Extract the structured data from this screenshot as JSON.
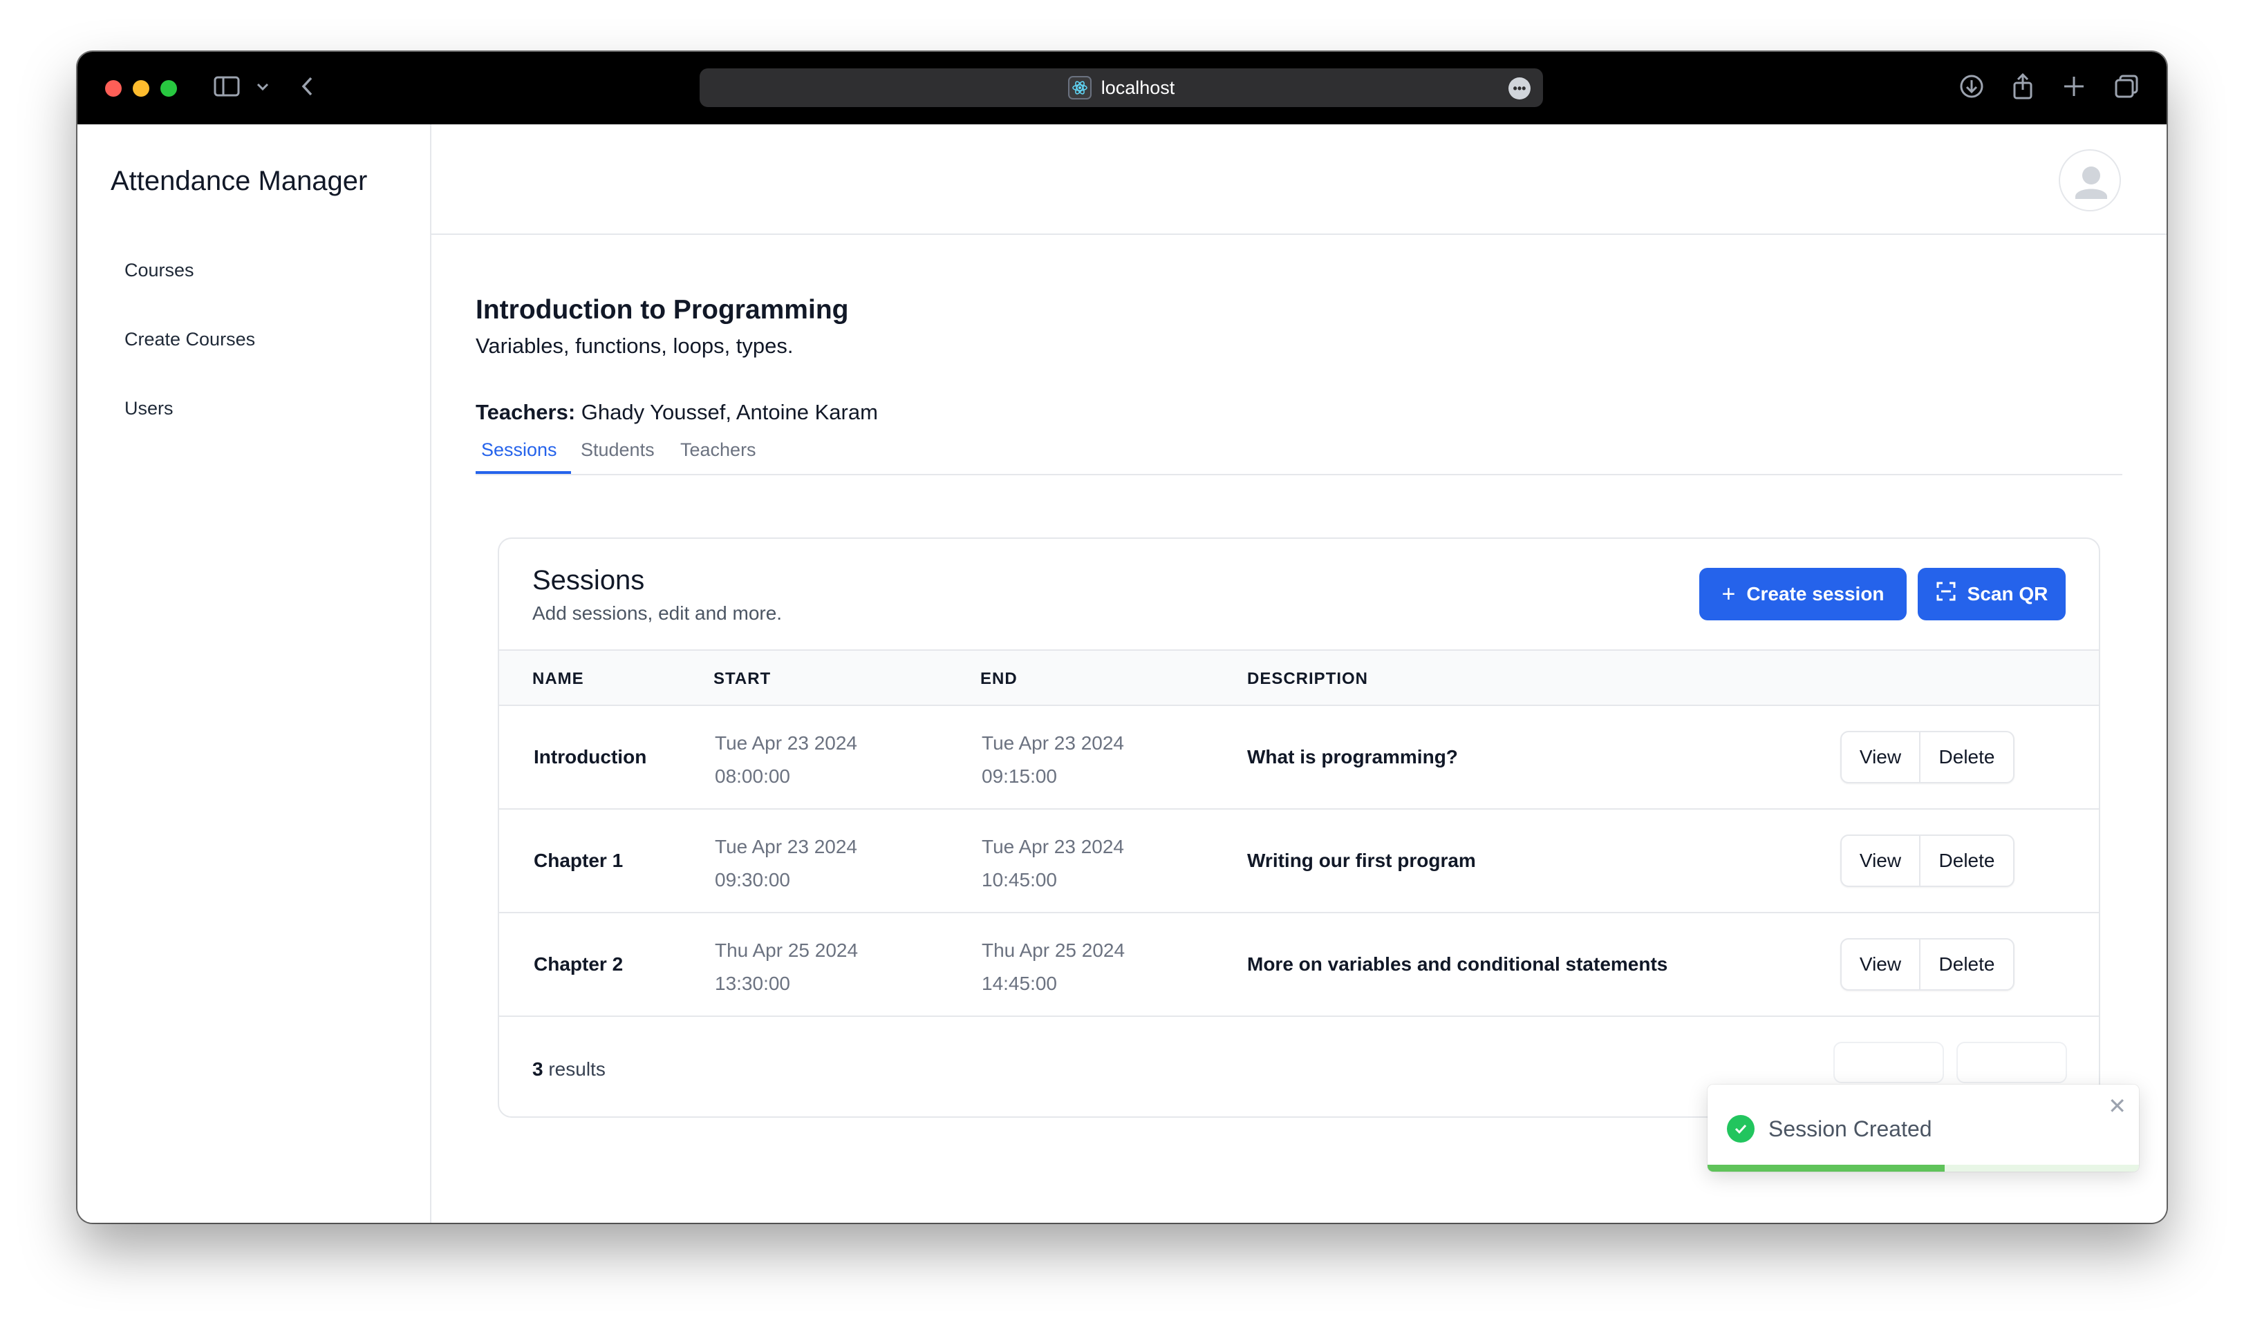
{
  "browser": {
    "url": "localhost",
    "site_icon": "react-atom-icon"
  },
  "sidebar": {
    "brand": "Attendance Manager",
    "items": [
      {
        "label": "Courses"
      },
      {
        "label": "Create Courses"
      },
      {
        "label": "Users"
      }
    ]
  },
  "course": {
    "title": "Introduction to Programming",
    "description": "Variables, functions, loops, types.",
    "teachers_label": "Teachers:",
    "teachers": "Ghady Youssef, Antoine Karam"
  },
  "tabs": [
    {
      "label": "Sessions",
      "active": true
    },
    {
      "label": "Students",
      "active": false
    },
    {
      "label": "Teachers",
      "active": false
    }
  ],
  "sessions_card": {
    "title": "Sessions",
    "subtitle": "Add sessions, edit and more.",
    "create_button": "Create session",
    "scan_button": "Scan QR",
    "columns": [
      "NAME",
      "START",
      "END",
      "DESCRIPTION"
    ],
    "rows": [
      {
        "name": "Introduction",
        "start_date": "Tue Apr 23 2024",
        "start_time": "08:00:00",
        "end_date": "Tue Apr 23 2024",
        "end_time": "09:15:00",
        "description": "What is programming?",
        "view": "View",
        "delete": "Delete"
      },
      {
        "name": "Chapter 1",
        "start_date": "Tue Apr 23 2024",
        "start_time": "09:30:00",
        "end_date": "Tue Apr 23 2024",
        "end_time": "10:45:00",
        "description": "Writing our first program",
        "view": "View",
        "delete": "Delete"
      },
      {
        "name": "Chapter 2",
        "start_date": "Thu Apr 25 2024",
        "start_time": "13:30:00",
        "end_date": "Thu Apr 25 2024",
        "end_time": "14:45:00",
        "description": "More on variables and conditional statements",
        "view": "View",
        "delete": "Delete"
      }
    ],
    "results_count": "3",
    "results_label": " results"
  },
  "toast": {
    "message": "Session Created",
    "progress": 0.55,
    "accent": "#22c55e"
  },
  "colors": {
    "primary": "#2563eb",
    "success": "#22c55e"
  }
}
